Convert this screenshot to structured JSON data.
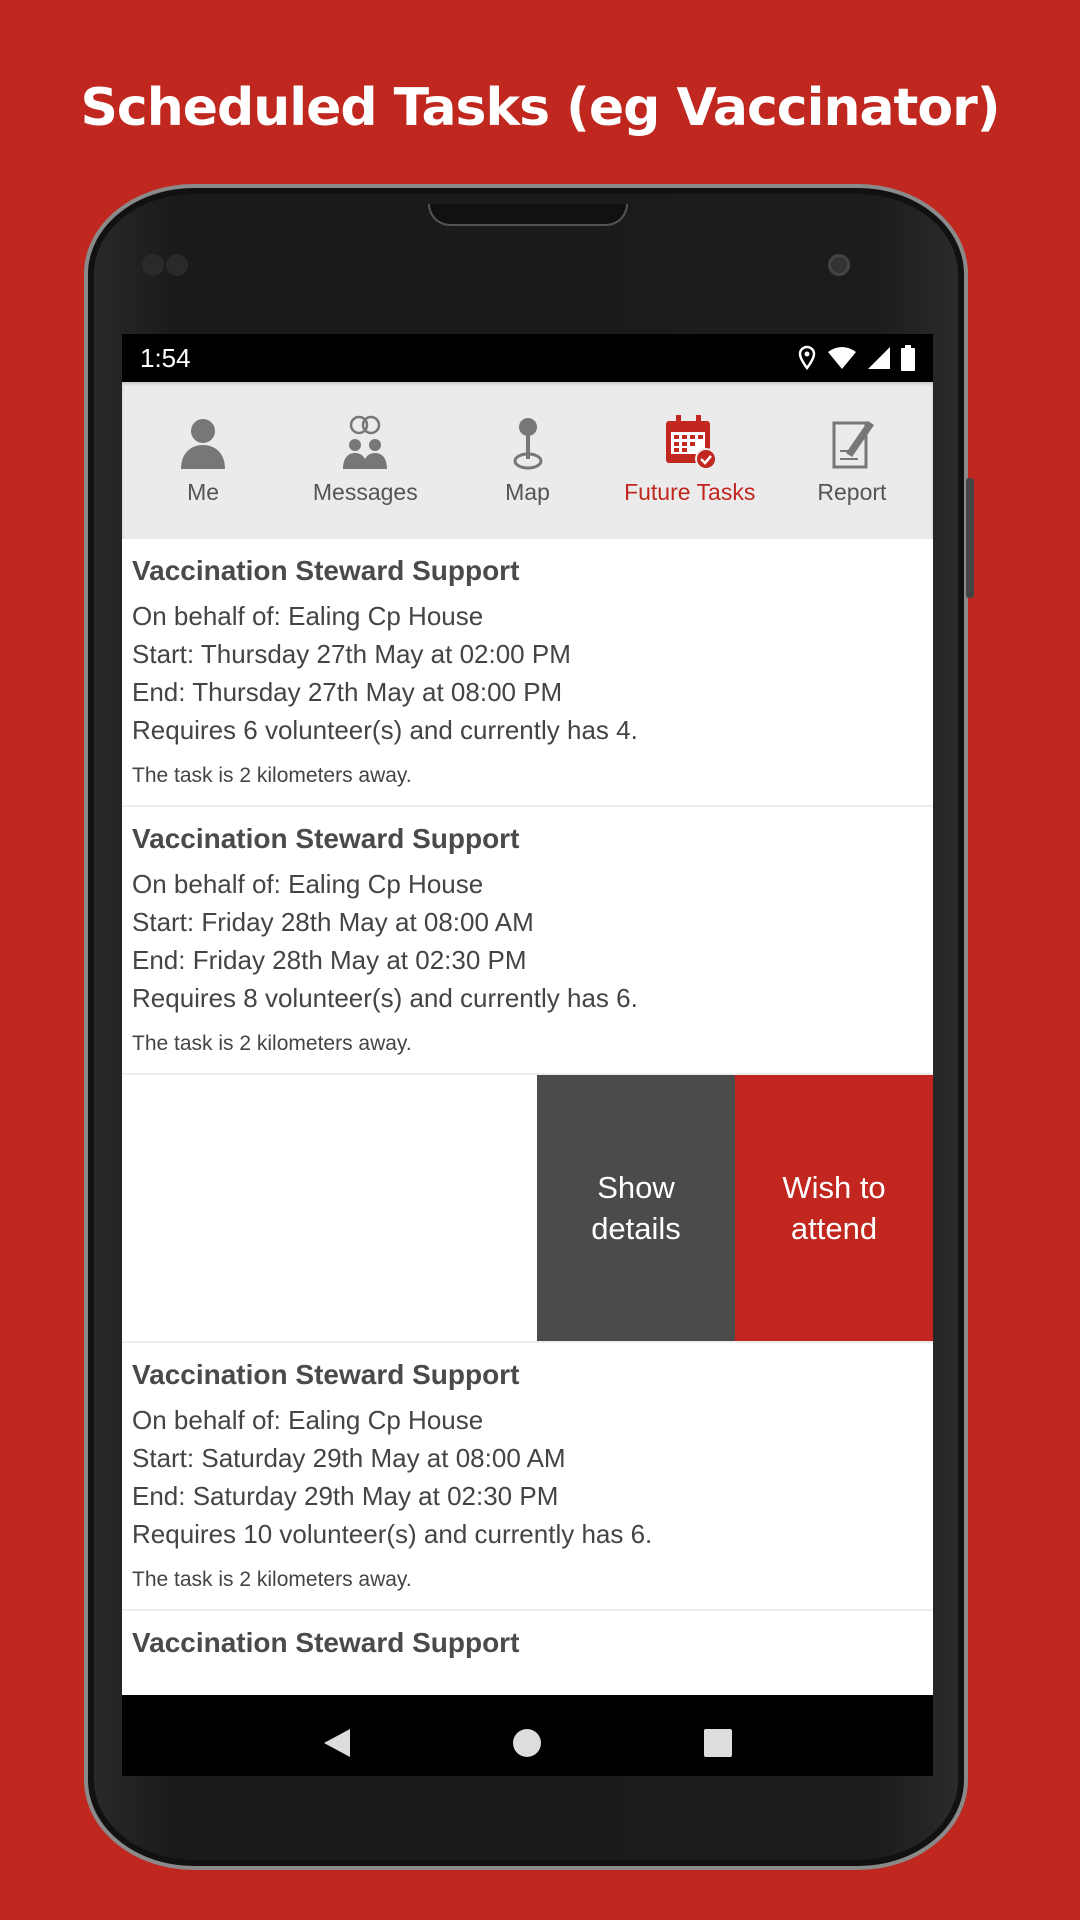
{
  "headline": "Scheduled Tasks (eg Vaccinator)",
  "status_bar": {
    "time": "1:54",
    "icons": [
      "location-icon",
      "wifi-icon",
      "signal-icon",
      "battery-icon"
    ]
  },
  "tabs": [
    {
      "label": "Me",
      "icon": "person-icon",
      "active": false
    },
    {
      "label": "Messages",
      "icon": "people-chat-icon",
      "active": false
    },
    {
      "label": "Map",
      "icon": "map-pin-icon",
      "active": false
    },
    {
      "label": "Future Tasks",
      "icon": "calendar-check-icon",
      "active": true
    },
    {
      "label": "Report",
      "icon": "report-edit-icon",
      "active": false
    }
  ],
  "tasks": [
    {
      "title": "Vaccination Steward Support",
      "behalf": "On behalf of: Ealing Cp House",
      "start": "Start: Thursday 27th May at 02:00 PM",
      "end": "End: Thursday 27th May at 08:00 PM",
      "requires": "Requires 6 volunteer(s) and currently has 4.",
      "distance": "The task is 2 kilometers away."
    },
    {
      "title": "Vaccination Steward Support",
      "behalf": "On behalf of: Ealing Cp House",
      "start": "Start: Friday 28th May at 08:00 AM",
      "end": "End: Friday 28th May at 02:30 PM",
      "requires": "Requires 8 volunteer(s) and currently has 6.",
      "distance": "The task is 2 kilometers away."
    },
    {
      "title": "Vaccination Steward Support",
      "behalf": "On behalf of: Ealing Cp House",
      "start": "Start: Saturday 29th May at 08:00 AM",
      "end": "End: Saturday 29th May at 02:30 PM",
      "requires": "Requires 10 volunteer(s) and currently has 6.",
      "distance": "The task is 2 kilometers away."
    },
    {
      "title": "Vaccination Steward Support"
    }
  ],
  "swipe_actions": {
    "show_details": "Show details",
    "wish_to_attend": "Wish to attend"
  },
  "colors": {
    "brand_red": "#c1271e",
    "action_dark": "#4b4b4b",
    "background": "#c0271e"
  }
}
